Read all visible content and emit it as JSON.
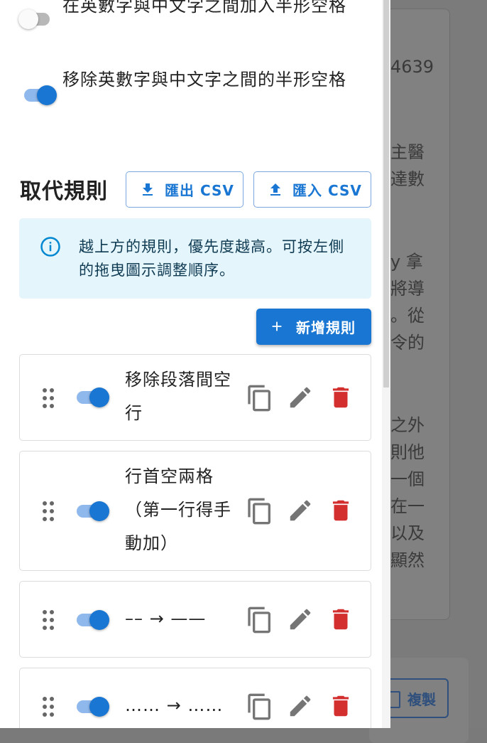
{
  "background": {
    "fragments": [
      "4639",
      "主醫",
      "達數",
      "y 拿",
      "將導",
      "。從",
      "令的",
      "之外",
      "則他",
      "一個",
      "在一",
      "以及",
      "顯然"
    ],
    "copy_button_label": "複製"
  },
  "options": [
    {
      "label": "在英數字與中文字之間加入半形空格",
      "enabled": false
    },
    {
      "label": "移除英數字與中文字之間的半形空格",
      "enabled": true
    }
  ],
  "replace_rules": {
    "title": "取代規則",
    "export_label": "匯出 CSV",
    "import_label": "匯入 CSV",
    "info_text": "越上方的規則，優先度越高。可按左側的拖曳圖示調整順序。",
    "add_label": "新增規則",
    "rules": [
      {
        "label": "移除段落間空行",
        "enabled": true
      },
      {
        "label": "行首空兩格（第一行得手動加）",
        "enabled": true
      },
      {
        "label": "–– → ——",
        "enabled": true
      },
      {
        "label": "…… → ……",
        "enabled": true
      }
    ]
  },
  "colors": {
    "primary": "#1976d2",
    "danger": "#d32f2f",
    "info_bg": "#e5f5fc"
  }
}
